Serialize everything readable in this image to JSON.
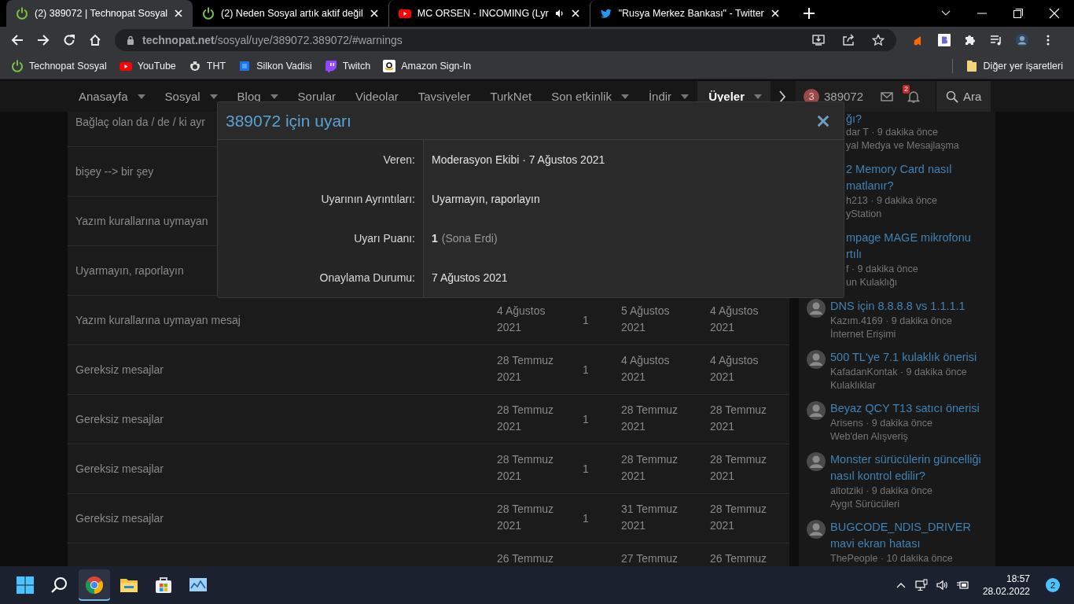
{
  "browser": {
    "tabs": [
      {
        "title": "(2) 389072 | Technopat Sosyal",
        "kind": "power",
        "selected": true,
        "audio": false
      },
      {
        "title": "(2) Neden Sosyal artık aktif değil",
        "kind": "power",
        "selected": false,
        "audio": false
      },
      {
        "title": "MC ORSEN - INCOMING (Lyr",
        "kind": "youtube",
        "selected": false,
        "audio": true
      },
      {
        "title": "\"Rusya Merkez Bankası\" - Twitter",
        "kind": "twitter",
        "selected": false,
        "audio": false
      }
    ],
    "url": "**technopat.net**/sosyal/uye/389072.389072/#warnings",
    "bookmarks": [
      {
        "label": "Technopat Sosyal",
        "kind": "power"
      },
      {
        "label": "YouTube",
        "kind": "youtube"
      },
      {
        "label": "THT",
        "kind": "tht"
      },
      {
        "label": "Silkon Vadisi",
        "kind": "chip"
      },
      {
        "label": "Twitch",
        "kind": "twitch"
      },
      {
        "label": "Amazon Sign-In",
        "kind": "amazon"
      }
    ],
    "other_bookmarks": "Diğer yer işaretleri"
  },
  "site_nav": {
    "items": [
      {
        "label": "Anasayfa",
        "dropdown": true,
        "selected": false
      },
      {
        "label": "Sosyal",
        "dropdown": true,
        "selected": false
      },
      {
        "label": "Blog",
        "dropdown": true,
        "selected": false
      },
      {
        "label": "Sorular",
        "dropdown": false,
        "selected": false
      },
      {
        "label": "Videolar",
        "dropdown": false,
        "selected": false
      },
      {
        "label": "Tavsiyeler",
        "dropdown": false,
        "selected": false
      },
      {
        "label": "TurkNet",
        "dropdown": false,
        "selected": false
      },
      {
        "label": "Son etkinlik",
        "dropdown": true,
        "selected": false
      },
      {
        "label": "İndir",
        "dropdown": true,
        "selected": false
      },
      {
        "label": "Üyeler",
        "dropdown": true,
        "selected": true
      }
    ],
    "user_badge": "3",
    "user_name": "389072",
    "alerts_badge": "2",
    "search": "Ara"
  },
  "warnings": {
    "rows": [
      {
        "column_1": "Bağlaç olan da / de / ki ayr"
      },
      {
        "column_1": "bişey --> bir şey"
      },
      {
        "column_1": "Yazım kurallarına uymayan"
      },
      {
        "column_1": "Uyarmayın, raporlayın"
      },
      {
        "column_1": "Yazım kurallarına uymayan mesaj",
        "column_2": "4 Ağustos 2021",
        "column_3": "1",
        "column_4": "5 Ağustos 2021",
        "column_5": "4 Ağustos 2021"
      },
      {
        "column_1": "Gereksiz mesajlar",
        "column_2": "28 Temmuz 2021",
        "column_3": "1",
        "column_4": "4 Ağustos 2021",
        "column_5": "4 Ağustos 2021"
      },
      {
        "column_1": "Gereksiz mesajlar",
        "column_2": "28 Temmuz 2021",
        "column_3": "1",
        "column_4": "28 Temmuz 2021",
        "column_5": "28 Temmuz 2021"
      },
      {
        "column_1": "Gereksiz mesajlar",
        "column_2": "28 Temmuz 2021",
        "column_3": "1",
        "column_4": "28 Temmuz 2021",
        "column_5": "28 Temmuz 2021"
      },
      {
        "column_1": "Gereksiz mesajlar",
        "column_2": "28 Temmuz 2021",
        "column_3": "1",
        "column_4": "31 Temmuz 2021",
        "column_5": "28 Temmuz 2021"
      },
      {
        "column_2": "26 Temmuz",
        "column_4": "27 Temmuz",
        "column_5": "26 Temmuz"
      }
    ]
  },
  "sidebar": {
    "items": [
      {
        "kind": "covered",
        "title": "ğı?",
        "meta": "dar T · 9 dakika önce",
        "forum": "yal Medya ve Mesajlaşma"
      },
      {
        "kind": "covered",
        "title": "2 Memory Card nasıl matlanır?",
        "meta": "h213 · 9 dakika önce",
        "forum": "yStation"
      },
      {
        "kind": "covered",
        "title": "mpage MAGE mikrofonu rtılı",
        "meta": "f · 9 dakika önce",
        "forum": "un Kulaklığı"
      },
      {
        "kind": "full",
        "title": "DNS için 8.8.8.8 vs 1.1.1.1",
        "meta": "Kazım.4169 · 9 dakika önce",
        "forum": "İnternet Erişimi"
      },
      {
        "kind": "full",
        "title": "500 TL'ye 7.1 kulaklık önerisi",
        "meta": "KafadanKontak · 9 dakika önce",
        "forum": "Kulaklıklar"
      },
      {
        "kind": "full",
        "title": "Beyaz QCY T13 satıcı önerisi",
        "meta": "Arisens · 9 dakika önce",
        "forum": "Web'den Alışveriş"
      },
      {
        "kind": "full",
        "title": "Monster sürücülerin güncelliği nasıl kontrol edilir?",
        "meta": "altotziki · 9 dakika önce",
        "forum": "Aygıt Sürücüleri"
      },
      {
        "kind": "full",
        "title": "BUGCODE_NDIS_DRIVER mavi ekran hatası",
        "meta": "ThePeople · 10 dakika önce"
      }
    ]
  },
  "modal": {
    "title": "389072 için uyarı",
    "fields": [
      {
        "label": "Veren:",
        "value": "Moderasyon Ekibi · 7 Ağustos 2021"
      },
      {
        "label": "Uyarının Ayrıntıları:",
        "value": "Uyarmayın, raporlayın"
      },
      {
        "label": "Uyarı Puanı:",
        "value": "**1**",
        "note": "(Sona Erdi)"
      },
      {
        "label": "Onaylama Durumu:",
        "value": "7 Ağustos 2021"
      }
    ]
  },
  "taskbar": {
    "apps": [
      {
        "kind": "start",
        "selected": false
      },
      {
        "kind": "search",
        "selected": false
      },
      {
        "kind": "chrome",
        "selected": true
      },
      {
        "kind": "folder",
        "selected": false
      },
      {
        "kind": "store",
        "selected": false
      },
      {
        "kind": "chart",
        "selected": false
      }
    ],
    "time": "18:57",
    "date": "28.02.2022",
    "notifications": "2"
  }
}
